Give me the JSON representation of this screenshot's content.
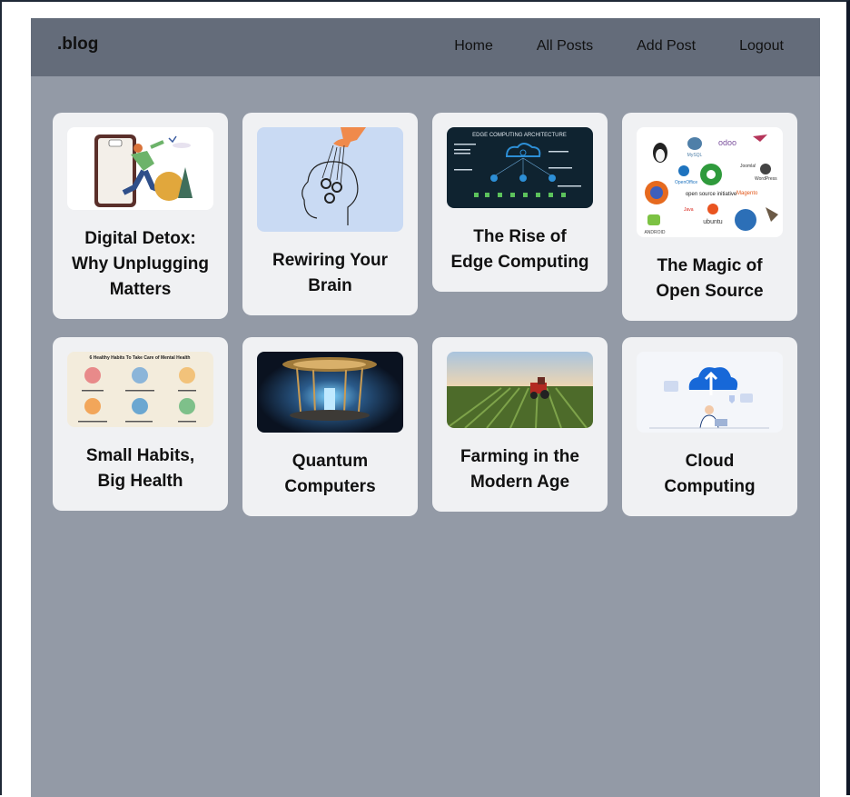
{
  "navbar": {
    "brand": ".blog",
    "links": [
      "Home",
      "All Posts",
      "Add Post",
      "Logout"
    ]
  },
  "posts": [
    {
      "title": "Digital Detox: Why Unplugging Matters",
      "image": "person-leaving-phone-illustration"
    },
    {
      "title": "Rewiring Your Brain",
      "image": "hand-puppeting-gears-head-illustration"
    },
    {
      "title": "The Rise of Edge Computing",
      "image": "edge-computing-architecture-diagram",
      "image_text": "EDGE COMPUTING ARCHITECTURE"
    },
    {
      "title": "The Magic of Open Source",
      "image": "open-source-logos-collage",
      "image_text": [
        "odoo",
        "open source initiative",
        "ubuntu",
        "Magento",
        "Joomla!",
        "WordPress",
        "MySQL",
        "OpenOffice",
        "Java",
        "ANDROID"
      ]
    },
    {
      "title": "Small Habits, Big Health",
      "image": "healthy-habits-infographic",
      "image_text": "6 Healthy Habits To Take Care of Mental Health"
    },
    {
      "title": "Quantum Computers",
      "image": "quantum-computer-photo"
    },
    {
      "title": "Farming in the Modern Age",
      "image": "tractor-field-photo"
    },
    {
      "title": "Cloud Computing",
      "image": "cloud-upload-illustration"
    }
  ]
}
